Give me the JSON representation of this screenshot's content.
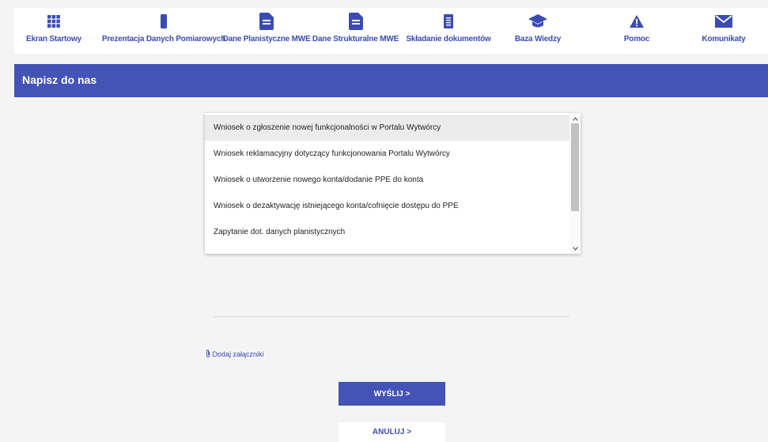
{
  "nav": {
    "items": [
      {
        "label": "Ekran Startowy",
        "icon": "grid-icon"
      },
      {
        "label": "Prezentacja Danych Pomiarowych",
        "icon": "phone-icon"
      },
      {
        "label": "Dane Planistyczne MWE",
        "icon": "document-icon"
      },
      {
        "label": "Dane Strukturalne MWE",
        "icon": "document-icon"
      },
      {
        "label": "Składanie dokumentów",
        "icon": "list-document-icon"
      },
      {
        "label": "Baza Wiedzy",
        "icon": "graduation-cap-icon"
      },
      {
        "label": "Pomoc",
        "icon": "warning-icon"
      },
      {
        "label": "Komunikaty",
        "icon": "envelope-icon"
      }
    ],
    "color": "#3a4cb2"
  },
  "banner": {
    "title": "Napisz do nas",
    "color": "#4453b6"
  },
  "request_type": {
    "options": [
      "Wniosek o zgłoszenie nowej funkcjonalności w Portalu Wytwórcy",
      "Wniosek reklamacyjny dotyczący funkcjonowania Portalu Wytwórcy",
      "Wniosek o utworzenie nowego konta/dodanie PPE do konta",
      "Wniosek o dezaktywację istniejącego konta/cofnięcie dostępu do PPE",
      "Zapytanie dot. danych planistycznych"
    ],
    "highlighted_index": 0
  },
  "attachments": {
    "label": "Dodaj załączniki",
    "icon": "paperclip-icon"
  },
  "actions": {
    "send_label": "WYŚLIJ >",
    "cancel_label": "ANULUJ >"
  }
}
